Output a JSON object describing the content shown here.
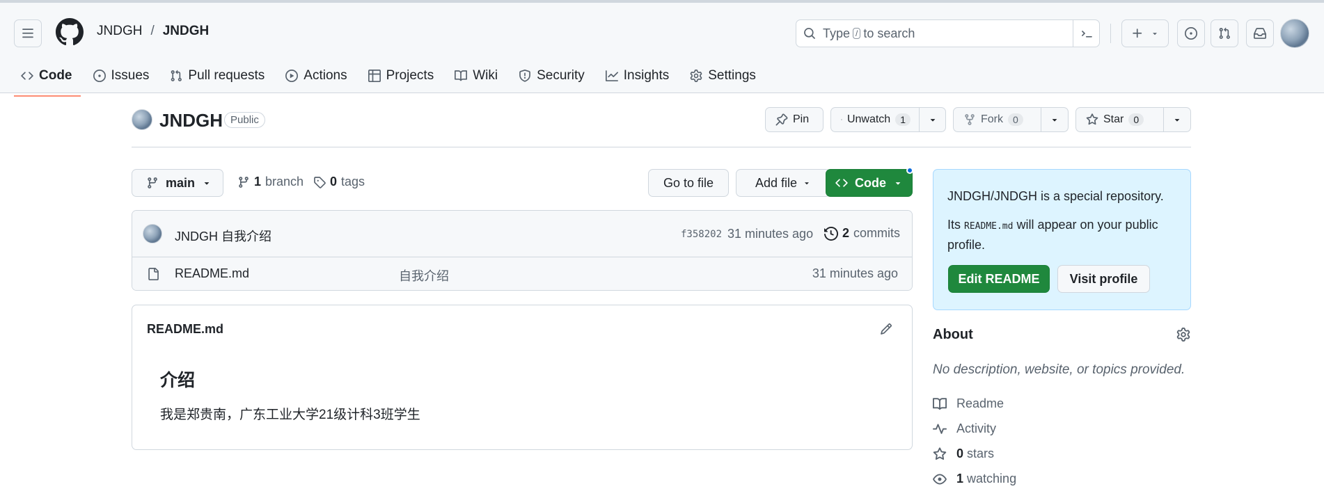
{
  "header": {
    "owner": "JNDGH",
    "separator": "/",
    "repo": "JNDGH",
    "search_prefix": "Type",
    "search_key": "/",
    "search_suffix": "to search"
  },
  "tabs": [
    {
      "label": "Code",
      "icon": "code-icon"
    },
    {
      "label": "Issues",
      "icon": "issue-icon"
    },
    {
      "label": "Pull requests",
      "icon": "pull-request-icon"
    },
    {
      "label": "Actions",
      "icon": "play-icon"
    },
    {
      "label": "Projects",
      "icon": "table-icon"
    },
    {
      "label": "Wiki",
      "icon": "book-icon"
    },
    {
      "label": "Security",
      "icon": "shield-icon"
    },
    {
      "label": "Insights",
      "icon": "graph-icon"
    },
    {
      "label": "Settings",
      "icon": "gear-icon"
    }
  ],
  "repo_header": {
    "name": "JNDGH",
    "visibility": "Public",
    "pin_label": "Pin",
    "unwatch_label": "Unwatch",
    "watch_count": "1",
    "fork_label": "Fork",
    "fork_count": "0",
    "star_label": "Star",
    "star_count": "0"
  },
  "toolbar": {
    "branch": "main",
    "branch_count": "1",
    "branch_label": "branch",
    "tag_count": "0",
    "tag_label": "tags",
    "goto_label": "Go to file",
    "addfile_label": "Add file",
    "code_label": "Code"
  },
  "commit": {
    "author_msg": "JNDGH 自我介绍",
    "sha": "f358202",
    "time": "31 minutes ago",
    "count": "2",
    "count_label": "commits"
  },
  "files": [
    {
      "name": "README.md",
      "message": "自我介绍",
      "time": "31 minutes ago"
    }
  ],
  "readme": {
    "title": "README.md",
    "heading": "介绍",
    "body": "我是郑贵南，广东工业大学21级计科3班学生"
  },
  "special": {
    "repo_full": "JNDGH/JNDGH",
    "line1_suffix": " is a special repository.",
    "line2_prefix": "Its ",
    "line2_code": "README.md",
    "line2_suffix": " will appear on your public profile.",
    "edit_label": "Edit README",
    "visit_label": "Visit profile"
  },
  "about": {
    "title": "About",
    "description": "No description, website, or topics provided.",
    "readme_label": "Readme",
    "activity_label": "Activity",
    "stars_count": "0",
    "stars_label": "stars",
    "watching_count": "1",
    "watching_label": "watching"
  },
  "colors": {
    "accent_green": "#1f883d",
    "tab_underline": "#fd8c73",
    "special_bg": "#ddf4ff",
    "notification_dot": "#0969da"
  }
}
